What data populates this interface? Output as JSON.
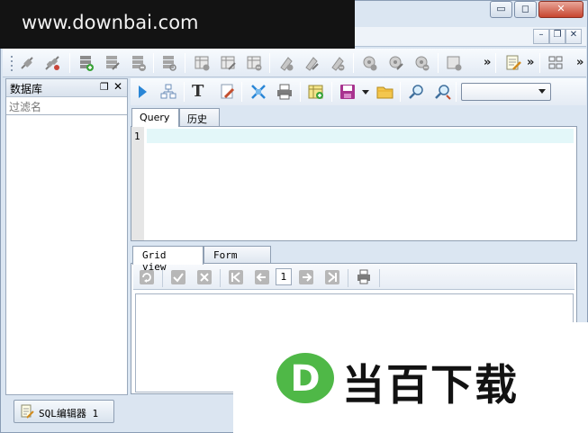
{
  "banner": {
    "text": "www.downbai.com"
  },
  "window": {
    "caption_buttons": {
      "minimize": "▭",
      "restore": "◻",
      "close": "✕"
    },
    "mdi_buttons": {
      "minimize": "–",
      "restore": "❐",
      "close": "✕"
    }
  },
  "toolbar": {
    "overflow_1": "»",
    "overflow_2": "»",
    "overflow_3": "»"
  },
  "left_panel": {
    "title": "数据库",
    "pin": "❐",
    "close": "✕",
    "filter_placeholder": "过滤名"
  },
  "editor": {
    "tabs": [
      {
        "label": "Query"
      },
      {
        "label": "历史"
      }
    ],
    "line_numbers": [
      "1"
    ]
  },
  "results": {
    "tabs": [
      {
        "label": "Grid view"
      },
      {
        "label": "Form view"
      }
    ],
    "page": "1"
  },
  "status": {
    "doc_tab": "SQL编辑器 1"
  },
  "logo": {
    "letter": "D",
    "text": "当百下载"
  },
  "colors": {
    "accent": "#4fb847",
    "banner_bg": "#131313",
    "current_line": "#e3f7f9"
  }
}
